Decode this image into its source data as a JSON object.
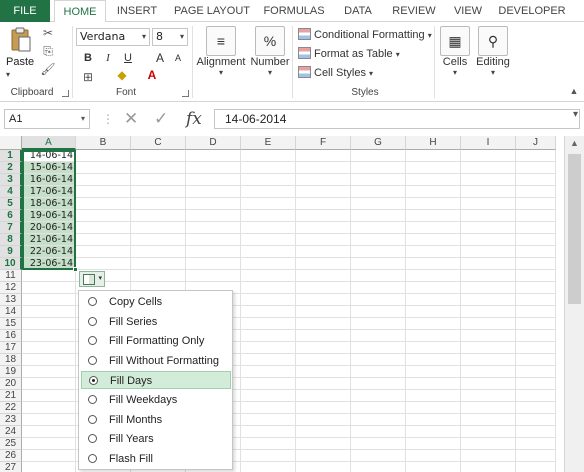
{
  "tabs": [
    "FILE",
    "HOME",
    "INSERT",
    "PAGE LAYOUT",
    "FORMULAS",
    "DATA",
    "REVIEW",
    "VIEW",
    "DEVELOPER"
  ],
  "ribbon": {
    "clipboard": {
      "paste": "Paste",
      "group": "Clipboard"
    },
    "font": {
      "name": "Verdana",
      "size": "8",
      "bold": "B",
      "italic": "I",
      "underline": "U",
      "grow": "A",
      "shrink": "A",
      "group": "Font"
    },
    "alignment": {
      "label": "Alignment"
    },
    "number": {
      "label": "Number",
      "symbol": "%"
    },
    "styles": {
      "conditional": "Conditional Formatting",
      "table": "Format as Table",
      "cell": "Cell Styles",
      "group": "Styles"
    },
    "cells": {
      "label": "Cells"
    },
    "editing": {
      "label": "Editing"
    }
  },
  "formula_bar": {
    "name_box": "A1",
    "content": "14-06-2014",
    "fx": "fx"
  },
  "columns": [
    "A",
    "B",
    "C",
    "D",
    "E",
    "F",
    "G",
    "H",
    "I",
    "J"
  ],
  "rows": [
    "1",
    "2",
    "3",
    "4",
    "5",
    "6",
    "7",
    "8",
    "9",
    "10",
    "11",
    "12",
    "13",
    "14",
    "15",
    "16",
    "17",
    "18",
    "19",
    "20",
    "21",
    "22",
    "23",
    "24",
    "25",
    "26",
    "27"
  ],
  "column_a": [
    "14-06-14",
    "15-06-14",
    "16-06-14",
    "17-06-14",
    "18-06-14",
    "19-06-14",
    "20-06-14",
    "21-06-14",
    "22-06-14",
    "23-06-14"
  ],
  "autofill_menu": [
    {
      "label": "Copy Cells",
      "selected": false
    },
    {
      "label": "Fill Series",
      "selected": false
    },
    {
      "label": "Fill Formatting Only",
      "selected": false
    },
    {
      "label": "Fill Without Formatting",
      "selected": false
    },
    {
      "label": "Fill Days",
      "selected": true
    },
    {
      "label": "Fill Weekdays",
      "selected": false
    },
    {
      "label": "Fill Months",
      "selected": false
    },
    {
      "label": "Fill Years",
      "selected": false
    },
    {
      "label": "Flash Fill",
      "selected": false
    }
  ],
  "colors": {
    "excel_green": "#217346",
    "selection_fill": "#c5dfc9",
    "menu_highlight": "#d3ecd9"
  }
}
